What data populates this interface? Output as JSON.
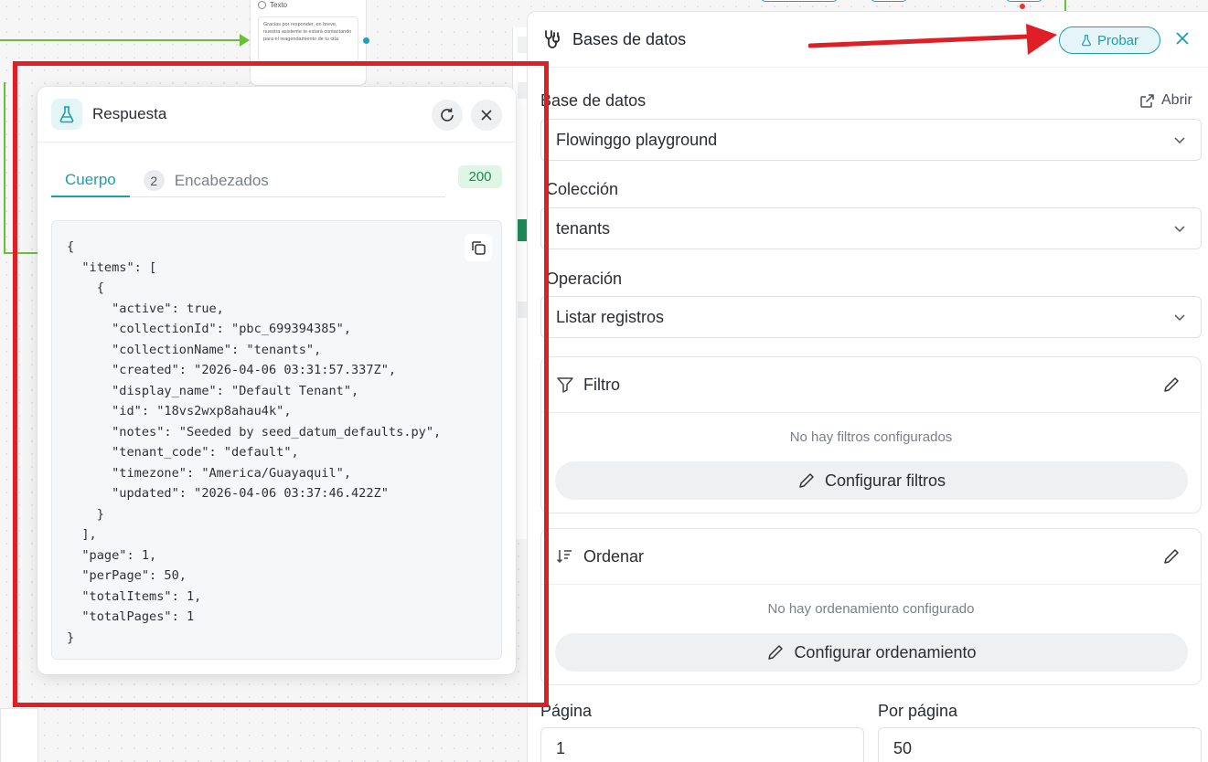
{
  "canvas": {
    "text_node": {
      "title": "Texto",
      "body": "Gracias por responder, en breve, nuestra asistente te estará contactando para el reagendamiento de tu cita"
    }
  },
  "response_panel": {
    "title": "Respuesta",
    "tabs": [
      {
        "label": "Cuerpo"
      },
      {
        "label": "Encabezados",
        "count": "2"
      }
    ],
    "status_code": "200",
    "body_json": "{\n  \"items\": [\n    {\n      \"active\": true,\n      \"collectionId\": \"pbc_699394385\",\n      \"collectionName\": \"tenants\",\n      \"created\": \"2026-04-06 03:31:57.337Z\",\n      \"display_name\": \"Default Tenant\",\n      \"id\": \"18vs2wxp8ahau4k\",\n      \"notes\": \"Seeded by seed_datum_defaults.py\",\n      \"tenant_code\": \"default\",\n      \"timezone\": \"America/Guayaquil\",\n      \"updated\": \"2026-04-06 03:37:46.422Z\"\n    }\n  ],\n  \"page\": 1,\n  \"perPage\": 50,\n  \"totalItems\": 1,\n  \"totalPages\": 1\n}"
  },
  "database_panel": {
    "title": "Bases de datos",
    "test_button": "Probar",
    "database": {
      "label": "Base de datos",
      "open_link": "Abrir",
      "value": "Flowinggo playground"
    },
    "collection": {
      "label": "Colección",
      "value": "tenants"
    },
    "operation": {
      "label": "Operación",
      "value": "Listar registros"
    },
    "filter": {
      "title": "Filtro",
      "empty_text": "No hay filtros configurados",
      "button": "Configurar filtros"
    },
    "sort": {
      "title": "Ordenar",
      "empty_text": "No hay ordenamiento configurado",
      "button": "Configurar ordenamiento"
    },
    "page": {
      "label": "Página",
      "value": "1"
    },
    "per_page": {
      "label": "Por página",
      "value": "50"
    }
  },
  "colors": {
    "accent": "#1a9fae",
    "annotation": "#e01e25",
    "success": "#1f8a4c",
    "edge": "#6abf3a"
  },
  "icons": [
    "flask-icon",
    "refresh-icon",
    "close-icon",
    "copy-icon",
    "database-plug-icon",
    "external-link-icon",
    "chevron-down-icon",
    "filter-icon",
    "sort-icon",
    "pencil-icon"
  ]
}
